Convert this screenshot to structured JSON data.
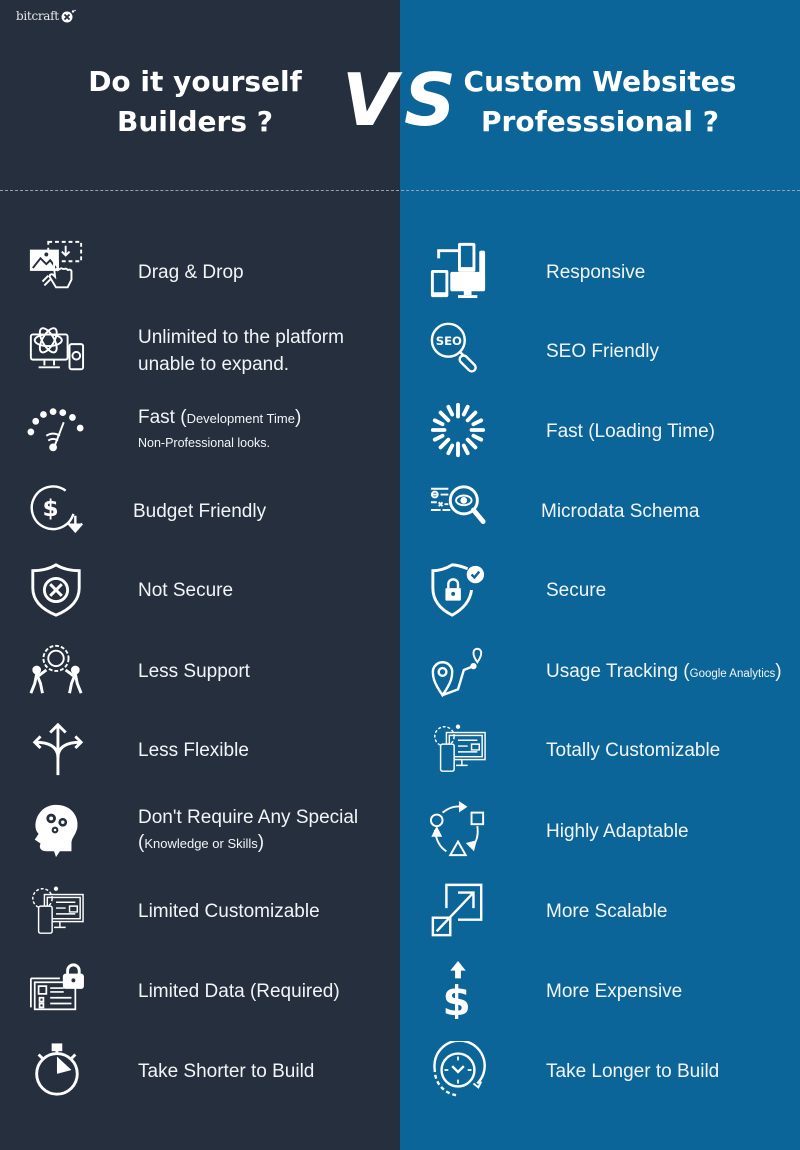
{
  "brand": {
    "logo_text": "bitcraft",
    "logo_icon": "x-mark-icon"
  },
  "colors": {
    "left_bg": "#262f3d",
    "right_bg": "#0c6598",
    "text": "#ffffff"
  },
  "header": {
    "left_title_line1": "Do it yourself",
    "left_title_line2": "Builders ?",
    "vs_v": "V",
    "vs_s": "S",
    "right_title_line1": "Custom Websites",
    "right_title_line2": "Professsional ?"
  },
  "left_items": [
    {
      "icon": "drag-drop-icon",
      "text": "Drag & Drop"
    },
    {
      "icon": "platform-devices-icon",
      "line1": "Unlimited to the platform",
      "line2": "unable to expand."
    },
    {
      "icon": "speedometer-icon",
      "main": "Fast ",
      "paren_open": "(",
      "paren_text": "Development Time",
      "paren_close": ")",
      "sub": "Non-Professional looks."
    },
    {
      "icon": "budget-dollar-down-icon",
      "text": "Budget Friendly"
    },
    {
      "icon": "shield-x-icon",
      "text": "Not Secure"
    },
    {
      "icon": "support-gear-people-icon",
      "text": "Less Support"
    },
    {
      "icon": "split-arrows-icon",
      "text": "Less Flexible"
    },
    {
      "icon": "head-gears-icon",
      "line1": "Don't Require Any Special",
      "paren_open": "(",
      "paren_text": "Knowledge or Skills",
      "paren_close": ")"
    },
    {
      "icon": "customize-devices-icon",
      "text": "Limited Customizable"
    },
    {
      "icon": "data-lock-icon",
      "text": "Limited Data (Required)"
    },
    {
      "icon": "stopwatch-icon",
      "text": "Take Shorter to Build"
    }
  ],
  "right_items": [
    {
      "icon": "responsive-devices-icon",
      "text": "Responsive"
    },
    {
      "icon": "seo-magnifier-icon",
      "text": "SEO Friendly"
    },
    {
      "icon": "loading-spinner-icon",
      "text": "Fast (Loading Time)"
    },
    {
      "icon": "microdata-search-icon",
      "text": "Microdata Schema"
    },
    {
      "icon": "shield-lock-check-icon",
      "text": "Secure"
    },
    {
      "icon": "location-route-icon",
      "main": "Usage Tracking ",
      "paren_open": "(",
      "paren_text": "Google Analytics",
      "paren_close": ")"
    },
    {
      "icon": "customize-devices-icon",
      "text": "Totally Customizable"
    },
    {
      "icon": "cycle-shapes-icon",
      "text": "Highly Adaptable"
    },
    {
      "icon": "scale-arrow-icon",
      "text": "More Scalable"
    },
    {
      "icon": "dollar-up-icon",
      "text": "More Expensive"
    },
    {
      "icon": "clock-cycle-icon",
      "text": "Take Longer to Build"
    }
  ]
}
